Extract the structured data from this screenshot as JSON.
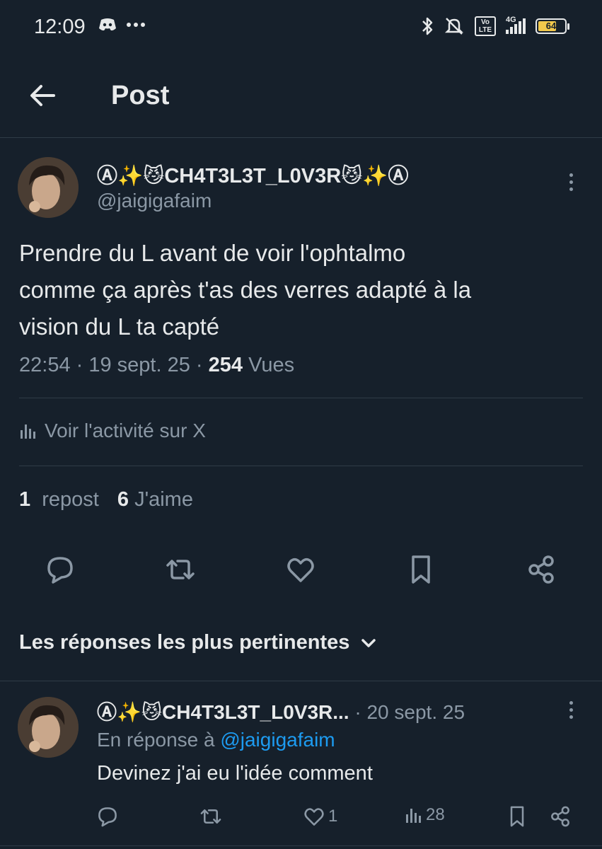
{
  "status_bar": {
    "time": "12:09",
    "network": "4G",
    "volte": "Vo LTE",
    "battery": "64",
    "icons": [
      "discord-icon",
      "ellipsis-icon",
      "bluetooth-icon",
      "mute-alarm-icon",
      "volte-icon",
      "signal-icon",
      "battery-icon"
    ]
  },
  "header": {
    "title": "Post",
    "back_icon": "arrow-left-icon"
  },
  "post": {
    "author_name": "Ⓐ✨😼CH4T3L3T_L0V3R😼✨Ⓐ",
    "author_handle": "@jaigigafaim",
    "text": "Prendre du L avant de voir l'ophtalmo\ncomme ça après t'as des verres adapté à la\nvision du L ta capté",
    "time": "22:54",
    "date": "19 sept. 25",
    "views_count": "254",
    "views_label": "Vues",
    "separator": " · ",
    "activity_label": "Voir l'activité sur X",
    "reposts_count": "1",
    "reposts_label": "repost",
    "likes_count": "6",
    "likes_label": "J'aime"
  },
  "actions": [
    "reply-icon",
    "repost-icon",
    "like-icon",
    "bookmark-icon",
    "share-icon"
  ],
  "replies_sort": {
    "label": "Les réponses les plus pertinentes"
  },
  "reply": {
    "author_name": "Ⓐ✨😼CH4T3L3T_L0V3R...",
    "separator": " · ",
    "date": "20 sept. 25",
    "context_prefix": "En réponse à ",
    "context_handle": "@jaigigafaim",
    "text": "Devinez j'ai eu l'idée comment",
    "likes": "1",
    "views": "28"
  },
  "colors": {
    "background": "#16202b",
    "text": "#e7e9ea",
    "muted": "#8b98a5",
    "link": "#1d9bf0",
    "divider": "#2f3b47"
  }
}
